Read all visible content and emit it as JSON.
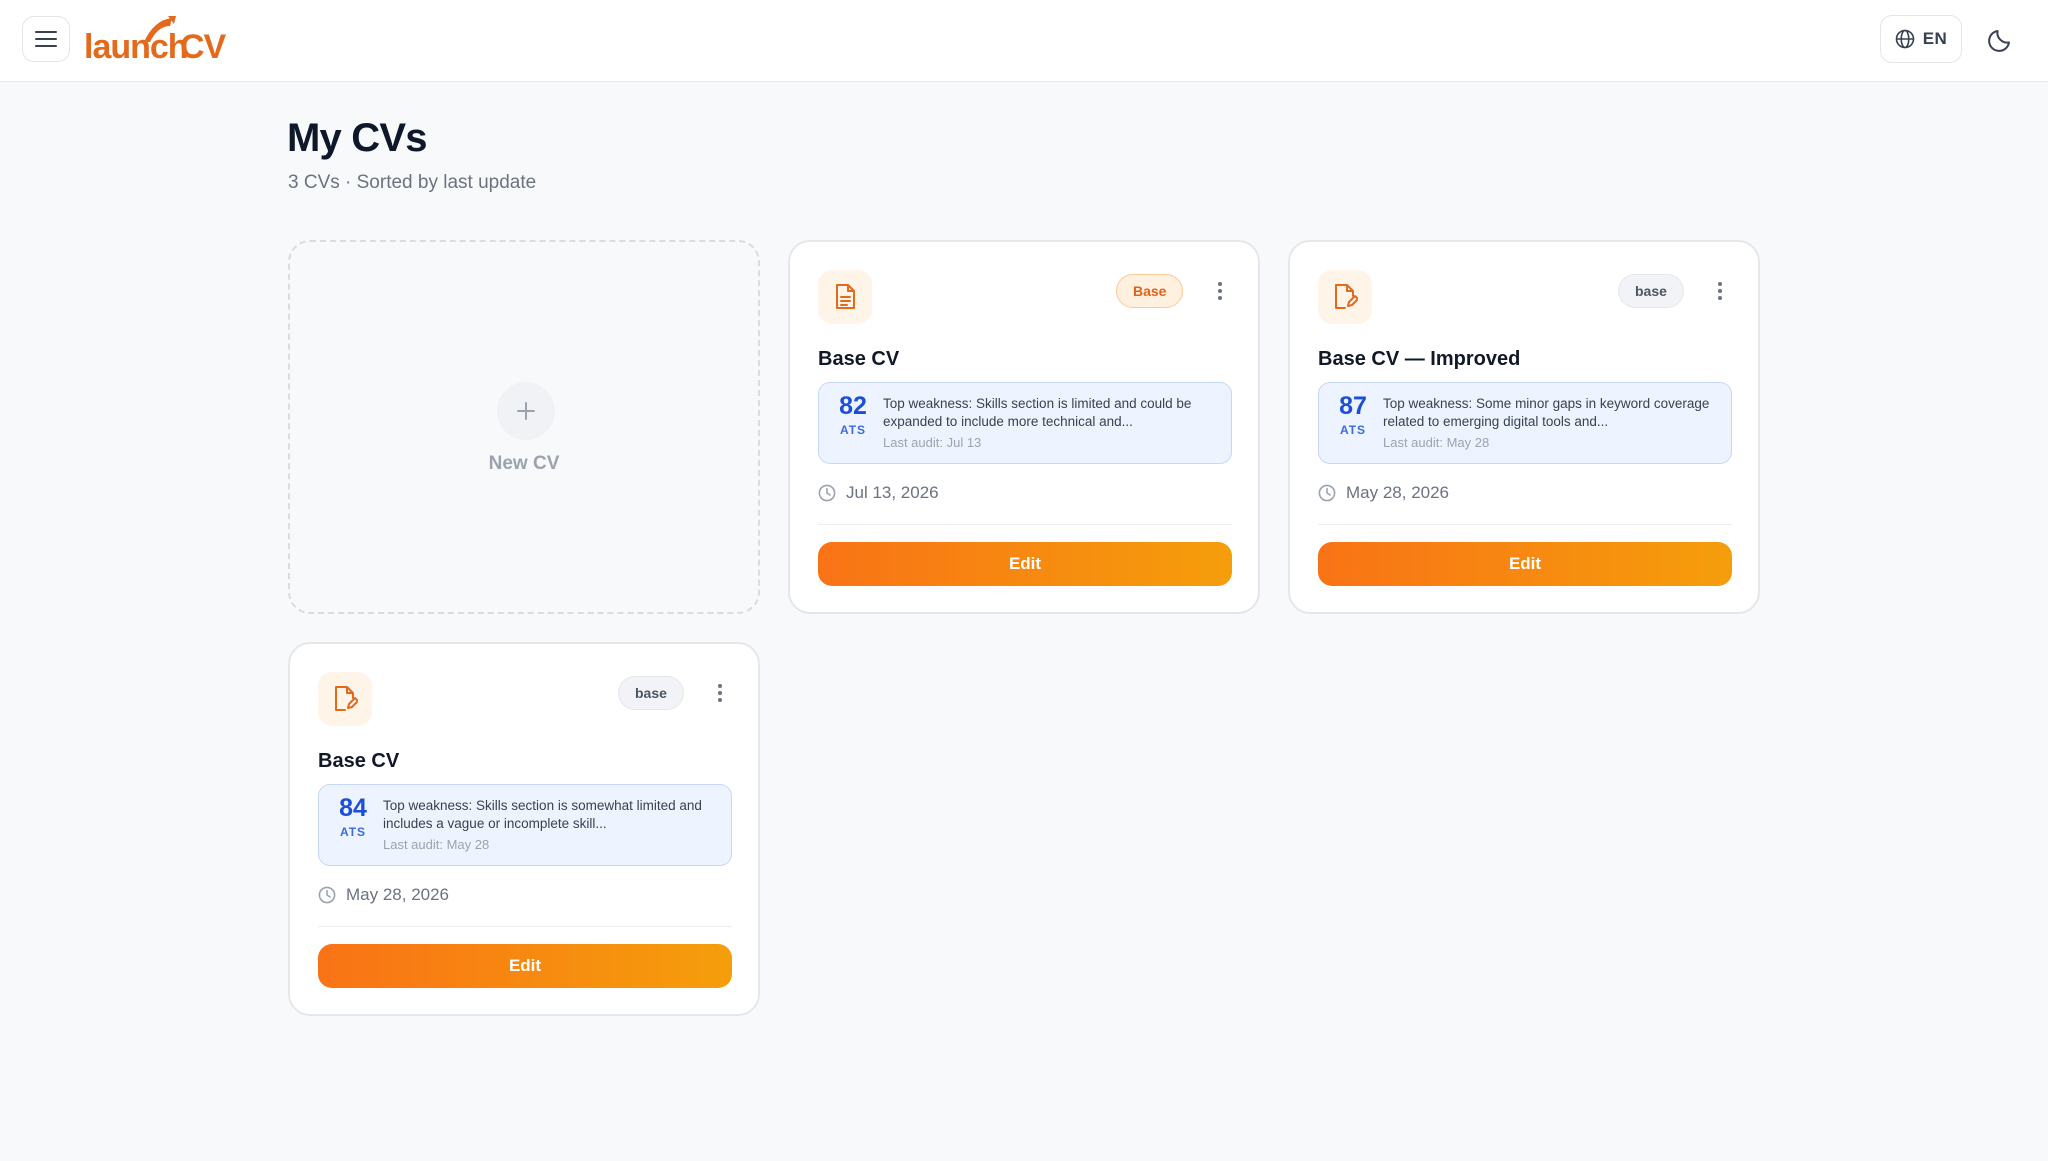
{
  "header": {
    "logo_text": "launchCV",
    "menu_icon": "hamburger-menu-icon",
    "language": "EN",
    "language_icon": "globe-icon",
    "theme_icon": "moon-icon"
  },
  "page": {
    "title": "My CVs",
    "subtitle": "3 CVs · Sorted by last update"
  },
  "new_cv": {
    "label": "New CV",
    "icon": "plus-icon"
  },
  "cvs": [
    {
      "icon": "document-icon",
      "badge": "Base",
      "title": "Base CV",
      "ats_score": "82",
      "ats_label": "ATS",
      "weakness": "Top weakness: Skills section is limited and could be expanded to include more technical and...",
      "last_audit": "Last audit: Jul 13",
      "date": "Jul 13, 2026",
      "edit_label": "Edit"
    },
    {
      "icon": "document-edit-icon",
      "badge": "base",
      "title": "Base CV — Improved",
      "ats_score": "87",
      "ats_label": "ATS",
      "weakness": "Top weakness: Some minor gaps in keyword coverage related to emerging digital tools and...",
      "last_audit": "Last audit: May 28",
      "date": "May 28, 2026",
      "edit_label": "Edit"
    },
    {
      "icon": "document-edit-icon",
      "badge": "base",
      "title": "Base CV",
      "ats_score": "84",
      "ats_label": "ATS",
      "weakness": "Top weakness: Skills section is somewhat limited and includes a vague or incomplete skill...",
      "last_audit": "Last audit: May 28",
      "date": "May 28, 2026",
      "edit_label": "Edit"
    }
  ],
  "colors": {
    "accent_start": "#f97316",
    "accent_end": "#f59e0b",
    "ats_blue": "#1d4ed8",
    "badge_orange": "#e0631b",
    "background": "#f8f9fb"
  }
}
